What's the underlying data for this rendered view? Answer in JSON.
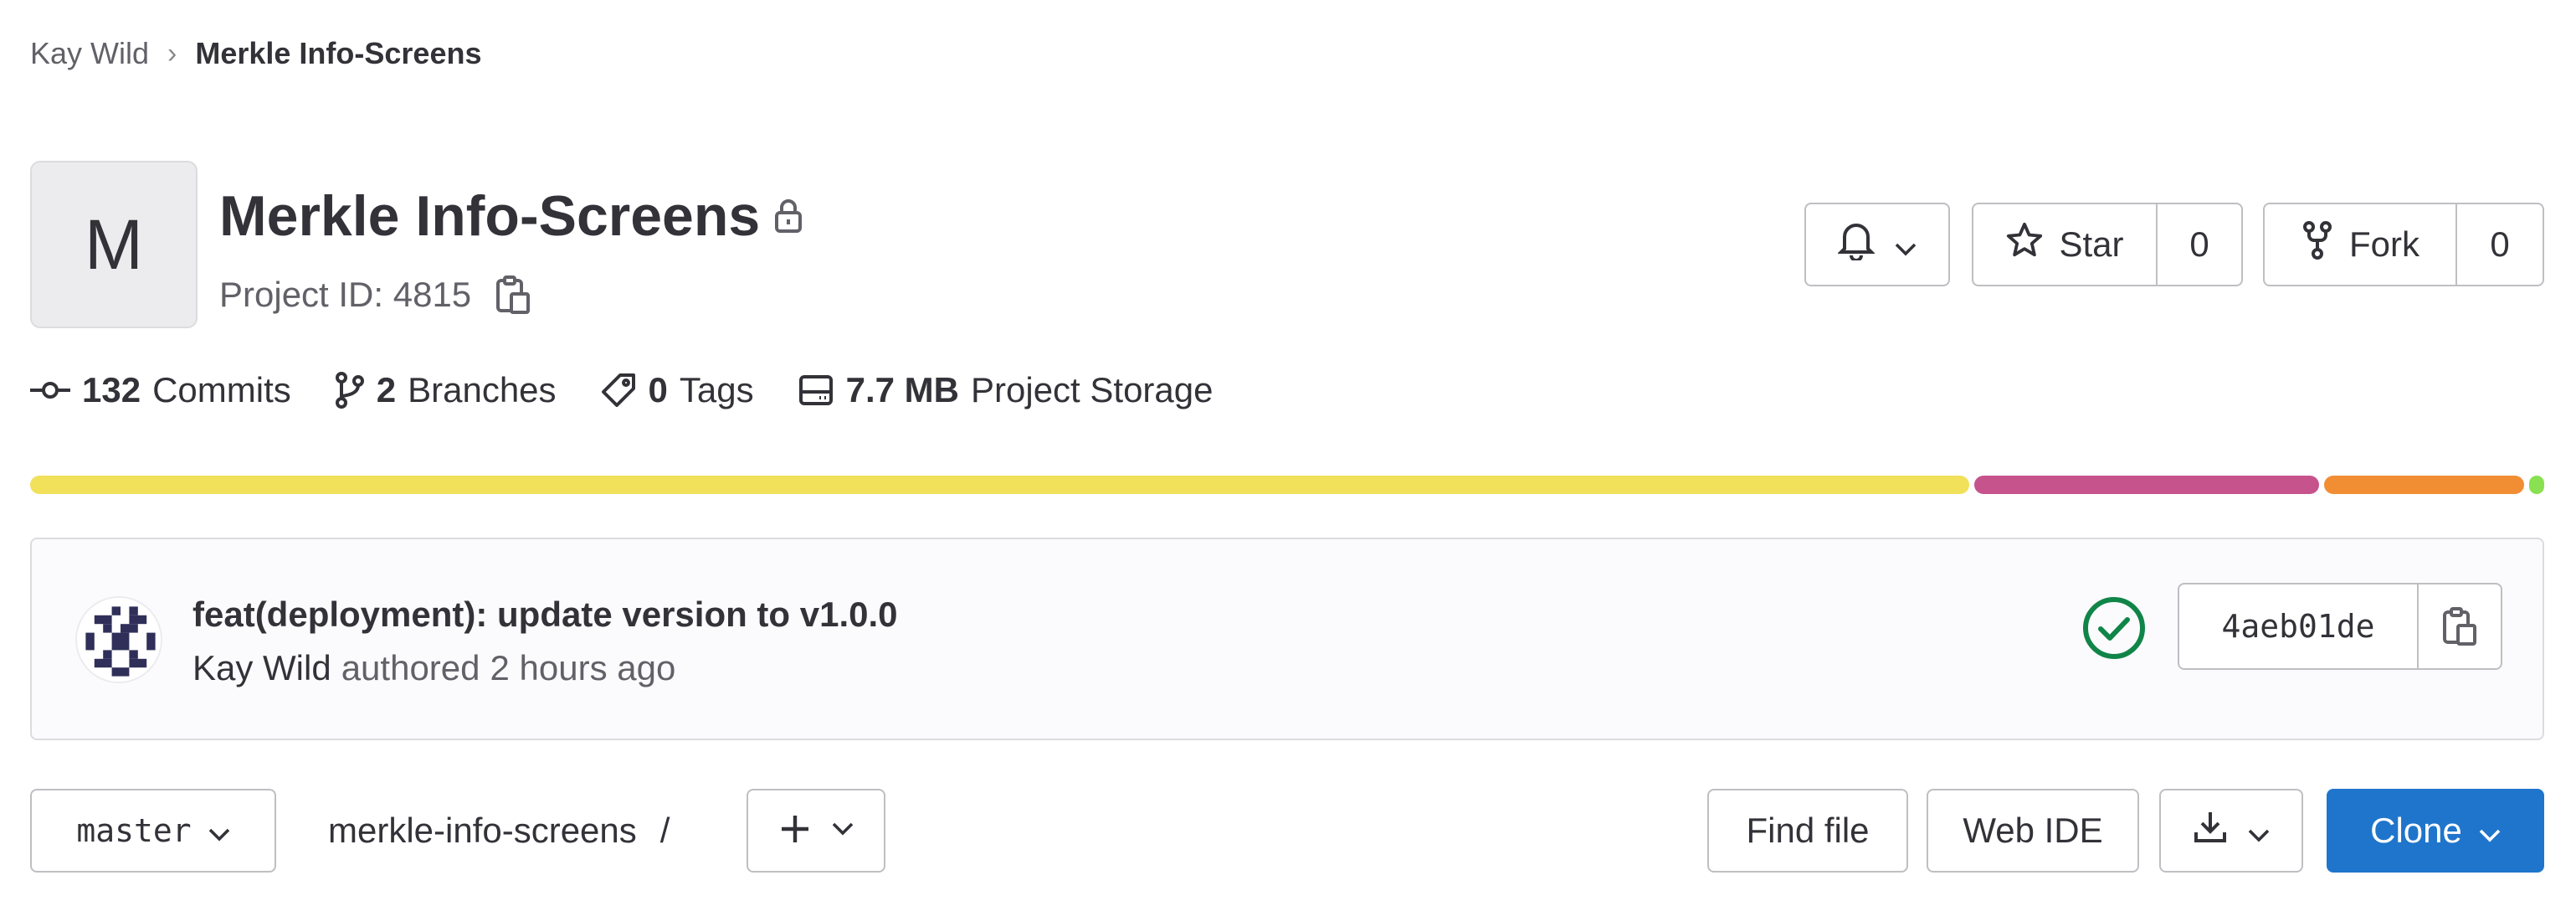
{
  "breadcrumb": {
    "parent": "Kay Wild",
    "separator": "›",
    "current": "Merkle Info-Screens"
  },
  "project": {
    "avatar_letter": "M",
    "title": "Merkle Info-Screens",
    "visibility_icon": "lock-icon",
    "id_text": "Project ID: 4815"
  },
  "actions": {
    "notifications_icon": "bell-icon",
    "star_label": "Star",
    "star_count": "0",
    "fork_label": "Fork",
    "fork_count": "0"
  },
  "stats": {
    "commits_count": "132",
    "commits_label": "Commits",
    "branches_count": "2",
    "branches_label": "Branches",
    "tags_count": "0",
    "tags_label": "Tags",
    "storage_size": "7.7 MB",
    "storage_label": "Project Storage"
  },
  "languages": [
    {
      "color": "#f1e05a",
      "fraction": 0.776
    },
    {
      "color": "#c6538c",
      "fraction": 0.138
    },
    {
      "color": "#f18e33",
      "fraction": 0.08
    },
    {
      "color": "#89e051",
      "fraction": 0.006
    }
  ],
  "last_commit": {
    "title": "feat(deployment): update version to v1.0.0",
    "author": "Kay Wild",
    "authored_label": "authored",
    "time_ago": "2 hours ago",
    "pipeline_status": "passed",
    "pipeline_color": "#108548",
    "sha": "4aeb01de"
  },
  "toolbar": {
    "branch": "master",
    "repo_path": "merkle-info-screens",
    "path_separator": "/",
    "find_file_label": "Find file",
    "web_ide_label": "Web IDE",
    "clone_label": "Clone",
    "accent": "#1f75cb"
  }
}
